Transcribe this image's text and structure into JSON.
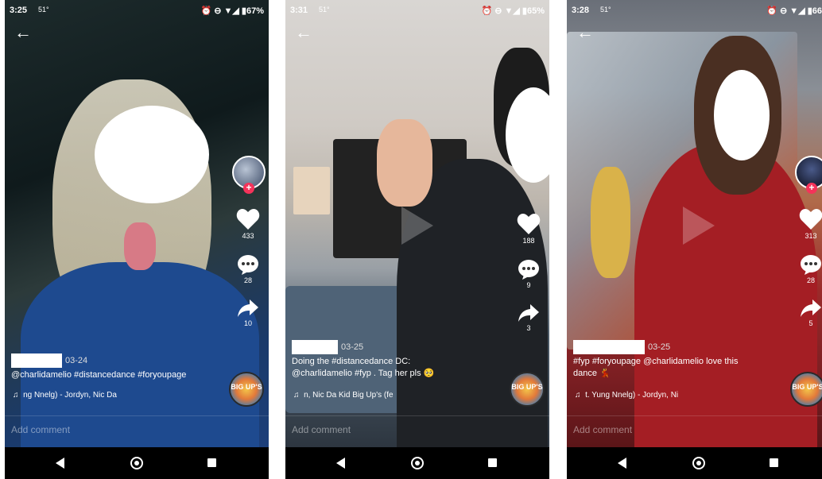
{
  "screens": [
    {
      "status": {
        "time": "3:25",
        "temp": "51°",
        "system": "⏰ ⊖ ▼◢ ▮67%"
      },
      "likes": "433",
      "comments": "28",
      "shares": "10",
      "date": "03-24",
      "caption": "@charlidamelio #distancedance #foryoupage",
      "music": "ng Nnelg) - Jordyn, Nic Da",
      "disc_label": "BIG UP'S",
      "add_comment": "Add comment"
    },
    {
      "status": {
        "time": "3:31",
        "temp": "51°",
        "system": "⏰ ⊖ ▼◢ ▮65%"
      },
      "likes": "188",
      "comments": "9",
      "shares": "3",
      "date": "03-25",
      "caption": "Doing the #distancedance DC: @charlidamelio #fyp . Tag her pls 🥺",
      "music": "n, Nic Da Kid    Big Up's (fe",
      "disc_label": "BIG UP'S",
      "add_comment": "Add comment"
    },
    {
      "status": {
        "time": "3:28",
        "temp": "51°",
        "system": "⏰ ⊖ ▼◢ ▮66"
      },
      "likes": "313",
      "comments": "28",
      "shares": "5",
      "date": "03-25",
      "caption": "#fyp #foryoupage @charlidamelio love this dance 💃",
      "music": "t. Yung Nnelg) - Jordyn, Ni",
      "disc_label": "BIG UP'S",
      "add_comment": "Add comment"
    }
  ],
  "colors": {
    "like_plus": "#f5335a",
    "navbar": "#000000"
  }
}
